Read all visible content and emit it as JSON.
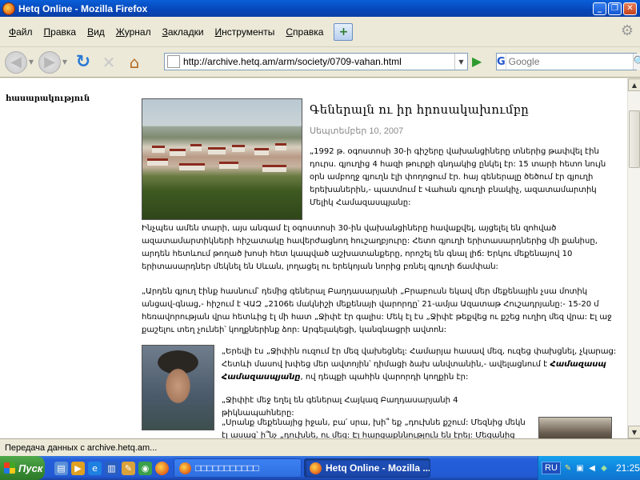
{
  "window": {
    "title": "Hetq Online - Mozilla Firefox",
    "min_glyph": "_",
    "max_glyph": "❐",
    "close_glyph": "✕"
  },
  "menu": {
    "items": [
      {
        "label": "Файл",
        "accel": "Ф",
        "rest": "айл"
      },
      {
        "label": "Правка",
        "accel": "П",
        "rest": "равка"
      },
      {
        "label": "Вид",
        "accel": "В",
        "rest": "ид"
      },
      {
        "label": "Журнал",
        "accel": "Ж",
        "rest": "урнал"
      },
      {
        "label": "Закладки",
        "accel": "З",
        "rest": "акладки"
      },
      {
        "label": "Инструменты",
        "accel": "И",
        "rest": "нструменты"
      },
      {
        "label": "Справка",
        "accel": "С",
        "rest": "правка"
      }
    ]
  },
  "nav": {
    "url": "http://archive.hetq.am/arm/society/0709-vahan.html",
    "search_engine": "G",
    "search_placeholder": "Google",
    "icons": {
      "back": "◀",
      "forward": "▶",
      "reload": "↻",
      "stop": "✕",
      "home": "⌂",
      "go": "▶",
      "search": "🔍",
      "dropdown": "▼"
    }
  },
  "page": {
    "sidebar_heading": "հասարակություն",
    "article_title": "Գեներալն ու իր հրոսակախումբը",
    "article_date": "Սեպտեմբեր 10, 2007",
    "p1": "„1992 թ. օգոստոսի 30-ի գիշերը վախանցիները տներից թափվել էին դուրս. գյուղից 4 հազի թուրքի գնդակից ընկել էր: 15 տարի հետո նույն օրն ամբողջ գյուղն էլի փողոցում էր. հայ գեներալը ծեծում էր գյուղի երեխաներին,- պատմում է Վահան գյուղի բնակիչ, ազատամարտիկ Մելիկ Համազասպյանը:",
    "p2": "Ինչպես ամեն տարի, այս անգամ էլ օգոստոսի 30-ին վախանցիները հավաքվել, այցելել են զոհված ազատամարտիկների հիշատակը հավերժացնող հուշաղբյուրը: Հետո գյուղի երիտասարդներից մի քանիսը, արդեն հետևում թողած խոսի հետ կապված աշխատանքերը, որոշել են գնալ լիճ: Երկու մեքենայով 10 երիտասարդներ մեկնել են Սևան, լողացել ու երեկոյան նորից բռնել գյուղի ճամփան:",
    "p3": "„Արդեն գյուղ էինք հասնում՝ դեմից գեներալ Բաղդասարյանի „Բրաբուսն եկավ մեր մեքենային չսա մոտիկ անցավ-գնաց,- հիշում է ՎԱԶ „2106ե մակնիշի մեքենայի վարորդը՝ 21-ամյա Ազատաթ Հուշադրյանը:- 15-20 մ հեռավորության վրա հետևից էլ մի հատ „Ջիփէ էր գալիս: Մեկ էլ էս „Ջիփէ թեքվեց ու քշեց ուղիղ մեզ վրա: Էլ աջ քաշելու տեղ չունեի՝ կողքներինք ձոր: Արգելակեցի, կանգնացրի ավտոն:",
    "p4_before": "„Երեվի էս „Ջիփին ուզում էր մեզ վախեցնել: Համարյա հասավ մեզ, ուզեց փախցնել, չկարաց: Հետևի մասով խփեց մեր ավտոյին՝ դիմացի ձախ անվտանին,- ավելացնում է ",
    "p4_bold": "Համազասպ Համազասպյանը",
    "p4_after": ", ով դեպքի պահին վարորդի կողքին էր:",
    "p5": "„Ջիփիէ մեջ եղել են գեներալ Հայկազ Բաղդասարյանի 4 թիկնապահները:",
    "p6": "„Սրանք մեքենայից իջան, բա՛ սրա, խի՞ եք „դուխնե քշում: Մեզնից մեկն էլ ասաց՝ ի՞նչ „դուխնե, ու մեզ: Էլ հարցաքննություն են էրել: Մեզանից մեկին"
  },
  "status": {
    "text": "Передача данных с archive.hetq.am..."
  },
  "taskbar": {
    "start_label": "Пуск",
    "inactive_task_label": "□□□□□□□□□□□",
    "active_task_label": "Hetq Online - Mozilla ...",
    "lang": "RU",
    "clock": "21:25"
  }
}
